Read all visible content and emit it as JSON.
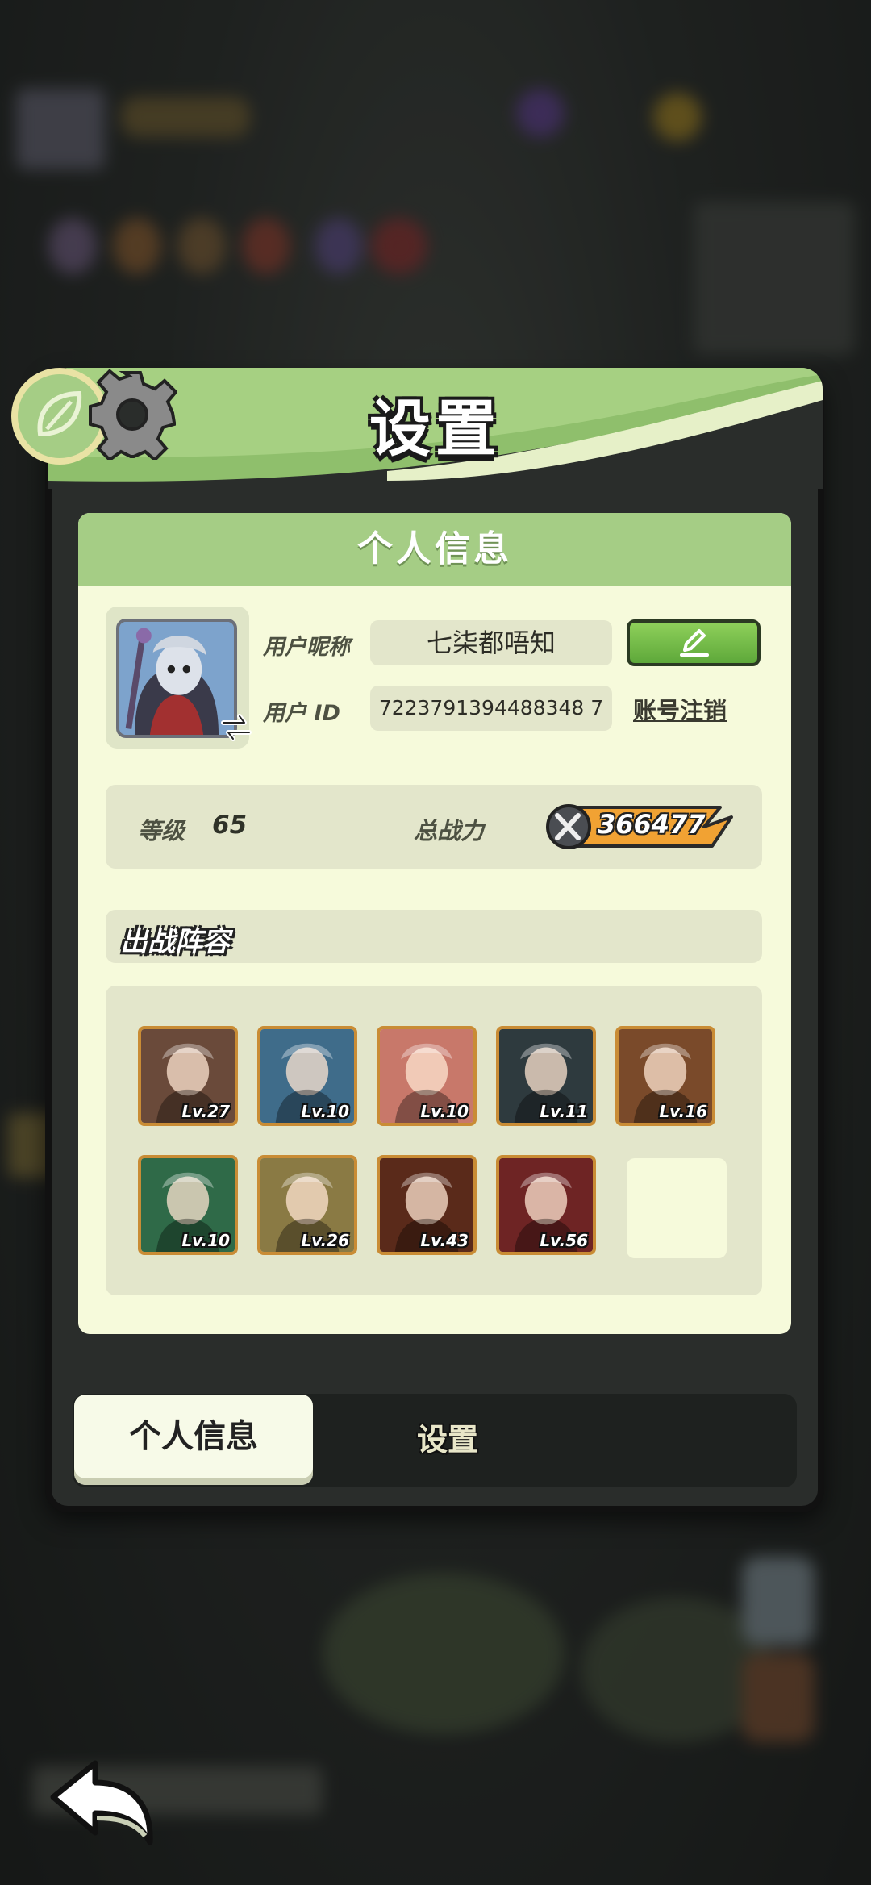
{
  "title": "设置",
  "section_title": "个人信息",
  "profile": {
    "nickname_label": "用户昵称",
    "nickname_value": "七柒都唔知",
    "id_label": "用户  ID",
    "id_value": "7223791394488348 7",
    "delete_account_label": "账号注销"
  },
  "stats": {
    "level_label": "等级",
    "level_value": "65",
    "power_label": "总战力",
    "power_value": "366477"
  },
  "lineup": {
    "title": "出战阵容",
    "heroes": [
      {
        "level": "Lv.27",
        "color": "#6a4a3a"
      },
      {
        "level": "Lv.10",
        "color": "#3f6c8a"
      },
      {
        "level": "Lv.10",
        "color": "#c8786a"
      },
      {
        "level": "Lv.11",
        "color": "#2e3a3e"
      },
      {
        "level": "Lv.16",
        "color": "#7a4a2a"
      },
      {
        "level": "Lv.10",
        "color": "#2f6a48"
      },
      {
        "level": "Lv.26",
        "color": "#8a7a44"
      },
      {
        "level": "Lv.43",
        "color": "#5a2a1a"
      },
      {
        "level": "Lv.56",
        "color": "#6e2424"
      }
    ]
  },
  "tabs": {
    "active": "个人信息",
    "other": "设置"
  },
  "colors": {
    "accent_green": "#a5cd85",
    "card_bg": "#f6fadb",
    "frame_gold": "#c98c35"
  }
}
